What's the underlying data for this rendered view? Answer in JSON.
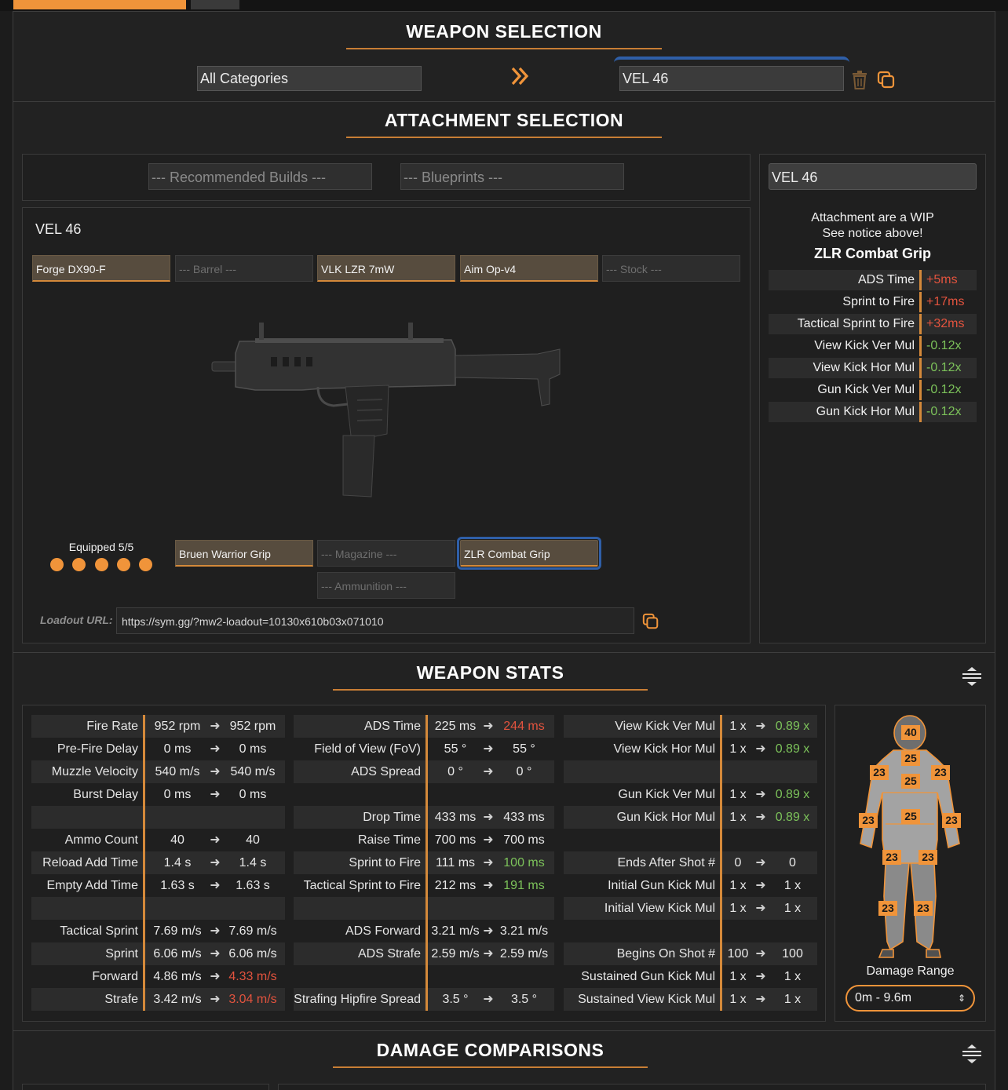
{
  "weapon_selection": {
    "title": "WEAPON SELECTION",
    "category_value": "All Categories",
    "weapon_value": "VEL 46",
    "icons": {
      "arrow": "double-chevron-right-icon",
      "delete": "trash-icon",
      "copy": "copy-icon"
    }
  },
  "attachment_selection": {
    "title": "ATTACHMENT SELECTION",
    "recommended_placeholder": "--- Recommended Builds ---",
    "blueprints_placeholder": "--- Blueprints ---",
    "weapon_name": "VEL 46",
    "slots_top": [
      {
        "label": "Forge DX90-F",
        "filled": true
      },
      {
        "label": "--- Barrel ---",
        "filled": false
      },
      {
        "label": "VLK LZR 7mW",
        "filled": true
      },
      {
        "label": "Aim Op-v4",
        "filled": true
      },
      {
        "label": "--- Stock ---",
        "filled": false
      }
    ],
    "equipped_label": "Equipped 5/5",
    "equipped_count": 5,
    "slots_bottom": [
      {
        "label": "Bruen Warrior Grip",
        "filled": true
      },
      {
        "label": "--- Magazine ---",
        "filled": false
      },
      {
        "label": "ZLR Combat Grip",
        "filled": true,
        "selected": true
      }
    ],
    "ammunition_placeholder": "--- Ammunition ---",
    "loadout_label": "Loadout URL:",
    "loadout_url": "https://sym.gg/?mw2-loadout=10130x610b03x071010",
    "info": {
      "weapon_select": "VEL 46",
      "notice_line1": "Attachment are a WIP",
      "notice_line2": "See notice above!",
      "attachment_name": "ZLR Combat Grip",
      "rows": [
        {
          "label": "ADS Time",
          "value": "+5ms",
          "tone": "neg"
        },
        {
          "label": "Sprint to Fire",
          "value": "+17ms",
          "tone": "neg"
        },
        {
          "label": "Tactical Sprint to Fire",
          "value": "+32ms",
          "tone": "neg"
        },
        {
          "label": "View Kick Ver Mul",
          "value": "-0.12x",
          "tone": "pos"
        },
        {
          "label": "View Kick Hor Mul",
          "value": "-0.12x",
          "tone": "pos"
        },
        {
          "label": "Gun Kick Ver Mul",
          "value": "-0.12x",
          "tone": "pos"
        },
        {
          "label": "Gun Kick Hor Mul",
          "value": "-0.12x",
          "tone": "pos"
        }
      ]
    }
  },
  "weapon_stats": {
    "title": "WEAPON STATS",
    "arrow": "➜",
    "col1": [
      {
        "label": "Fire Rate",
        "a": "952 rpm",
        "b": "952 rpm",
        "tone": ""
      },
      {
        "label": "Pre-Fire Delay",
        "a": "0 ms",
        "b": "0 ms",
        "tone": ""
      },
      {
        "label": "Muzzle Velocity",
        "a": "540 m/s",
        "b": "540 m/s",
        "tone": ""
      },
      {
        "label": "Burst Delay",
        "a": "0 ms",
        "b": "0 ms",
        "tone": ""
      },
      {
        "label": "",
        "a": "",
        "b": "",
        "tone": ""
      },
      {
        "label": "Ammo Count",
        "a": "40",
        "b": "40",
        "tone": ""
      },
      {
        "label": "Reload Add Time",
        "a": "1.4 s",
        "b": "1.4 s",
        "tone": ""
      },
      {
        "label": "Empty Add Time",
        "a": "1.63 s",
        "b": "1.63 s",
        "tone": ""
      },
      {
        "label": "",
        "a": "",
        "b": "",
        "tone": ""
      },
      {
        "label": "Tactical Sprint",
        "a": "7.69 m/s",
        "b": "7.69 m/s",
        "tone": ""
      },
      {
        "label": "Sprint",
        "a": "6.06 m/s",
        "b": "6.06 m/s",
        "tone": ""
      },
      {
        "label": "Forward",
        "a": "4.86 m/s",
        "b": "4.33 m/s",
        "tone": "neg"
      },
      {
        "label": "Strafe",
        "a": "3.42 m/s",
        "b": "3.04 m/s",
        "tone": "neg"
      }
    ],
    "col2": [
      {
        "label": "ADS Time",
        "a": "225 ms",
        "b": "244 ms",
        "tone": "neg"
      },
      {
        "label": "Field of View (FoV)",
        "a": "55 °",
        "b": "55 °",
        "tone": ""
      },
      {
        "label": "ADS Spread",
        "a": "0 °",
        "b": "0 °",
        "tone": ""
      },
      {
        "label": "",
        "a": "",
        "b": "",
        "tone": ""
      },
      {
        "label": "Drop Time",
        "a": "433 ms",
        "b": "433 ms",
        "tone": ""
      },
      {
        "label": "Raise Time",
        "a": "700 ms",
        "b": "700 ms",
        "tone": ""
      },
      {
        "label": "Sprint to Fire",
        "a": "111 ms",
        "b": "100 ms",
        "tone": "pos"
      },
      {
        "label": "Tactical Sprint to Fire",
        "a": "212 ms",
        "b": "191 ms",
        "tone": "pos"
      },
      {
        "label": "",
        "a": "",
        "b": "",
        "tone": ""
      },
      {
        "label": "ADS Forward",
        "a": "3.21 m/s",
        "b": "3.21 m/s",
        "tone": ""
      },
      {
        "label": "ADS Strafe",
        "a": "2.59 m/s",
        "b": "2.59 m/s",
        "tone": ""
      },
      {
        "label": "",
        "a": "",
        "b": "",
        "tone": ""
      },
      {
        "label": "Strafing Hipfire Spread",
        "a": "3.5 °",
        "b": "3.5 °",
        "tone": ""
      }
    ],
    "col3": [
      {
        "label": "View Kick Ver Mul",
        "a": "1 x",
        "b": "0.89 x",
        "tone": "pos"
      },
      {
        "label": "View Kick Hor Mul",
        "a": "1 x",
        "b": "0.89 x",
        "tone": "pos"
      },
      {
        "label": "",
        "a": "",
        "b": "",
        "tone": ""
      },
      {
        "label": "Gun Kick Ver Mul",
        "a": "1 x",
        "b": "0.89 x",
        "tone": "pos"
      },
      {
        "label": "Gun Kick Hor Mul",
        "a": "1 x",
        "b": "0.89 x",
        "tone": "pos"
      },
      {
        "label": "",
        "a": "",
        "b": "",
        "tone": ""
      },
      {
        "label": "Ends After Shot #",
        "a": "0",
        "b": "0",
        "tone": ""
      },
      {
        "label": "Initial Gun Kick Mul",
        "a": "1 x",
        "b": "1 x",
        "tone": ""
      },
      {
        "label": "Initial View Kick Mul",
        "a": "1 x",
        "b": "1 x",
        "tone": ""
      },
      {
        "label": "",
        "a": "",
        "b": "",
        "tone": ""
      },
      {
        "label": "Begins On Shot #",
        "a": "100",
        "b": "100",
        "tone": ""
      },
      {
        "label": "Sustained Gun Kick Mul",
        "a": "1 x",
        "b": "1 x",
        "tone": ""
      },
      {
        "label": "Sustained View Kick Mul",
        "a": "1 x",
        "b": "1 x",
        "tone": ""
      }
    ],
    "body_damage": {
      "head": "40",
      "neck": "25",
      "upper_chest": "25",
      "shoulders": "23",
      "stomach": "25",
      "arms": "23",
      "legs_upper": "23",
      "legs_lower": "23"
    },
    "damage_range_label": "Damage Range",
    "damage_range_value": "0m - 9.6m",
    "collapse_icon": "expand-collapse-icon"
  },
  "damage_comparisons": {
    "title": "DAMAGE COMPARISONS"
  },
  "colors": {
    "accent": "#f0943a",
    "negative": "#e2533e",
    "positive": "#7cc25a",
    "selection": "#2f5fa8"
  }
}
